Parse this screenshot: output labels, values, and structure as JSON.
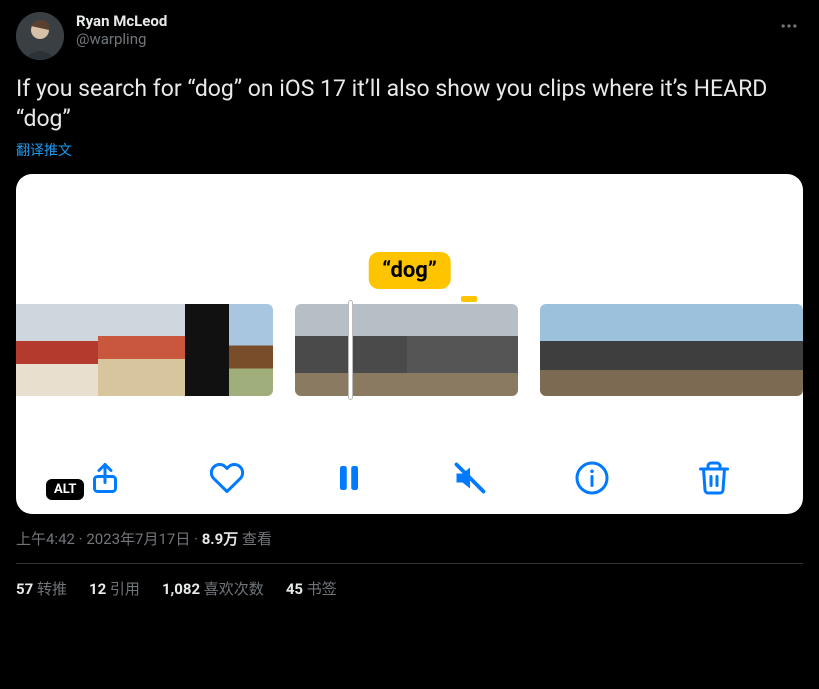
{
  "author": {
    "display_name": "Ryan McLeod",
    "handle": "@warpling"
  },
  "tweet_text": "If you search for “dog” on iOS 17 it’ll also show you clips where it’s HEARD “dog”",
  "translate_label": "翻译推文",
  "media": {
    "bubble_text": "“dog”",
    "alt_badge": "ALT"
  },
  "meta": {
    "time": "上午4:42",
    "date": "2023年7月17日",
    "views_count": "8.9万",
    "views_label": "查看",
    "separator": " · "
  },
  "stats": {
    "retweets": {
      "count": "57",
      "label": "转推"
    },
    "quotes": {
      "count": "12",
      "label": "引用"
    },
    "likes": {
      "count": "1,082",
      "label": "喜欢次数"
    },
    "bookmarks": {
      "count": "45",
      "label": "书签"
    }
  }
}
